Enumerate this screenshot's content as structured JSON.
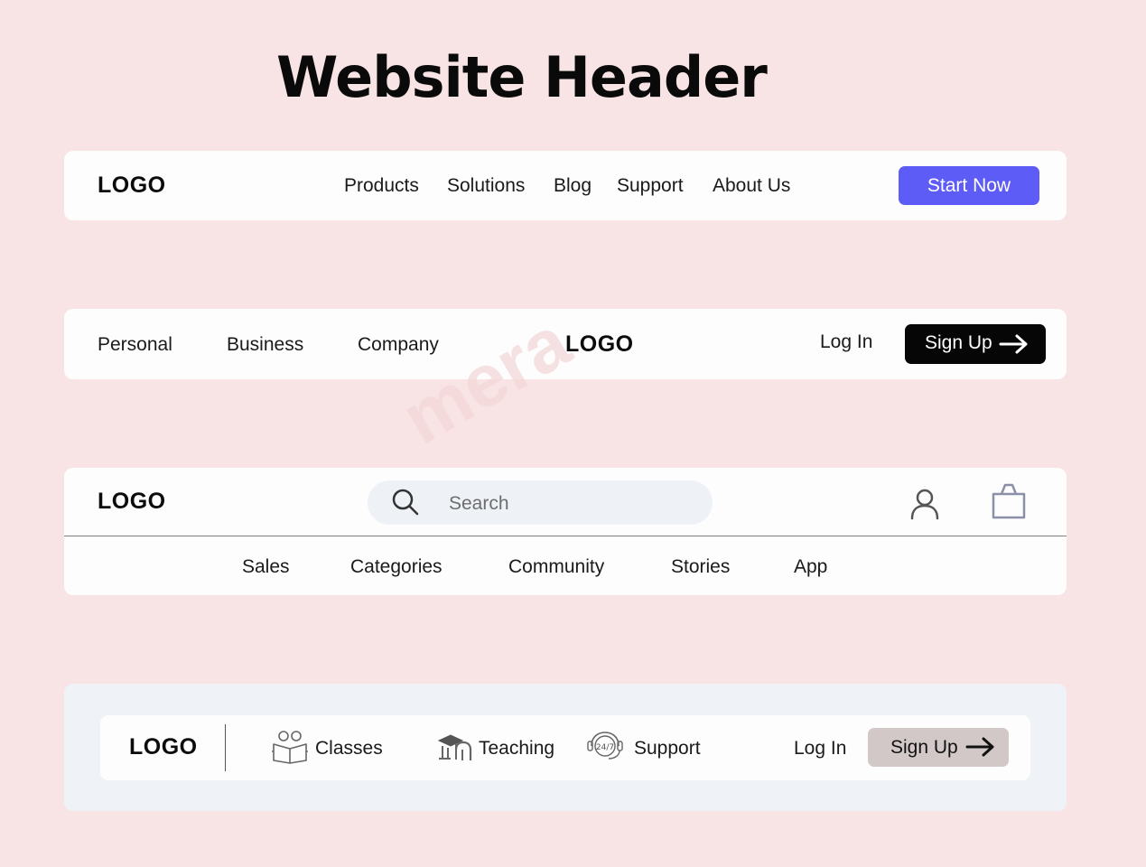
{
  "title": "Website Header",
  "header1": {
    "logo": "LOGO",
    "nav": [
      "Products",
      "Solutions",
      "Blog",
      "Support",
      "About Us"
    ],
    "cta": "Start Now",
    "cta_color": "#5e5cf6"
  },
  "header2": {
    "nav": [
      "Personal",
      "Business",
      "Company"
    ],
    "logo": "LOGO",
    "login": "Log In",
    "signup": "Sign Up",
    "signup_icon": "arrow-right-icon"
  },
  "header3": {
    "logo": "LOGO",
    "search": {
      "placeholder": "Search",
      "icon": "search-icon"
    },
    "icons": [
      "user-icon",
      "shopping-bag-icon"
    ],
    "nav": [
      "Sales",
      "Categories",
      "Community",
      "Stories",
      "App"
    ]
  },
  "header4": {
    "logo": "LOGO",
    "nav": [
      {
        "label": "Classes",
        "icon": "classes-icon"
      },
      {
        "label": "Teaching",
        "icon": "teaching-icon"
      },
      {
        "label": "Support",
        "icon": "support-24-7-icon"
      }
    ],
    "login": "Log In",
    "signup": "Sign Up",
    "signup_icon": "arrow-right-icon"
  }
}
